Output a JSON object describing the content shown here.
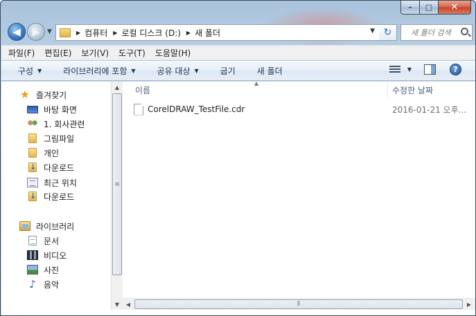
{
  "window": {
    "minimize_label": "–",
    "maximize_label": "□",
    "close_label": "✕"
  },
  "nav": {
    "back_glyph": "◀",
    "forward_glyph": "▶",
    "recent_glyph": "▼",
    "breadcrumb": [
      "컴퓨터",
      "로컬 디스크 (D:)",
      "새 폴더"
    ],
    "refresh_glyph": "↻",
    "search_placeholder": "새 폴더 검색"
  },
  "menubar": {
    "items": [
      "파일(F)",
      "편집(E)",
      "보기(V)",
      "도구(T)",
      "도움말(H)"
    ]
  },
  "toolbar": {
    "organize": "구성",
    "include_in_library": "라이브러리에 포함",
    "share_with": "공유 대상",
    "burn": "굽기",
    "new_folder": "새 폴더",
    "help_glyph": "?"
  },
  "sidebar": {
    "favorites": {
      "label": "즐겨찾기",
      "items": [
        "바탕 화면",
        "1. 회사관련",
        "그림파일",
        "개인",
        "다운로드",
        "최근 위치",
        "다운로드"
      ]
    },
    "libraries": {
      "label": "라이브러리",
      "items": [
        "문서",
        "비디오",
        "사진",
        "음악"
      ]
    },
    "computer": {
      "label": "컴퓨터"
    }
  },
  "content": {
    "columns": {
      "name": "이름",
      "date_modified": "수정한 날짜"
    },
    "files": [
      {
        "name": "CorelDRAW_TestFile.cdr",
        "date": "2016-01-21 오후..."
      }
    ]
  }
}
